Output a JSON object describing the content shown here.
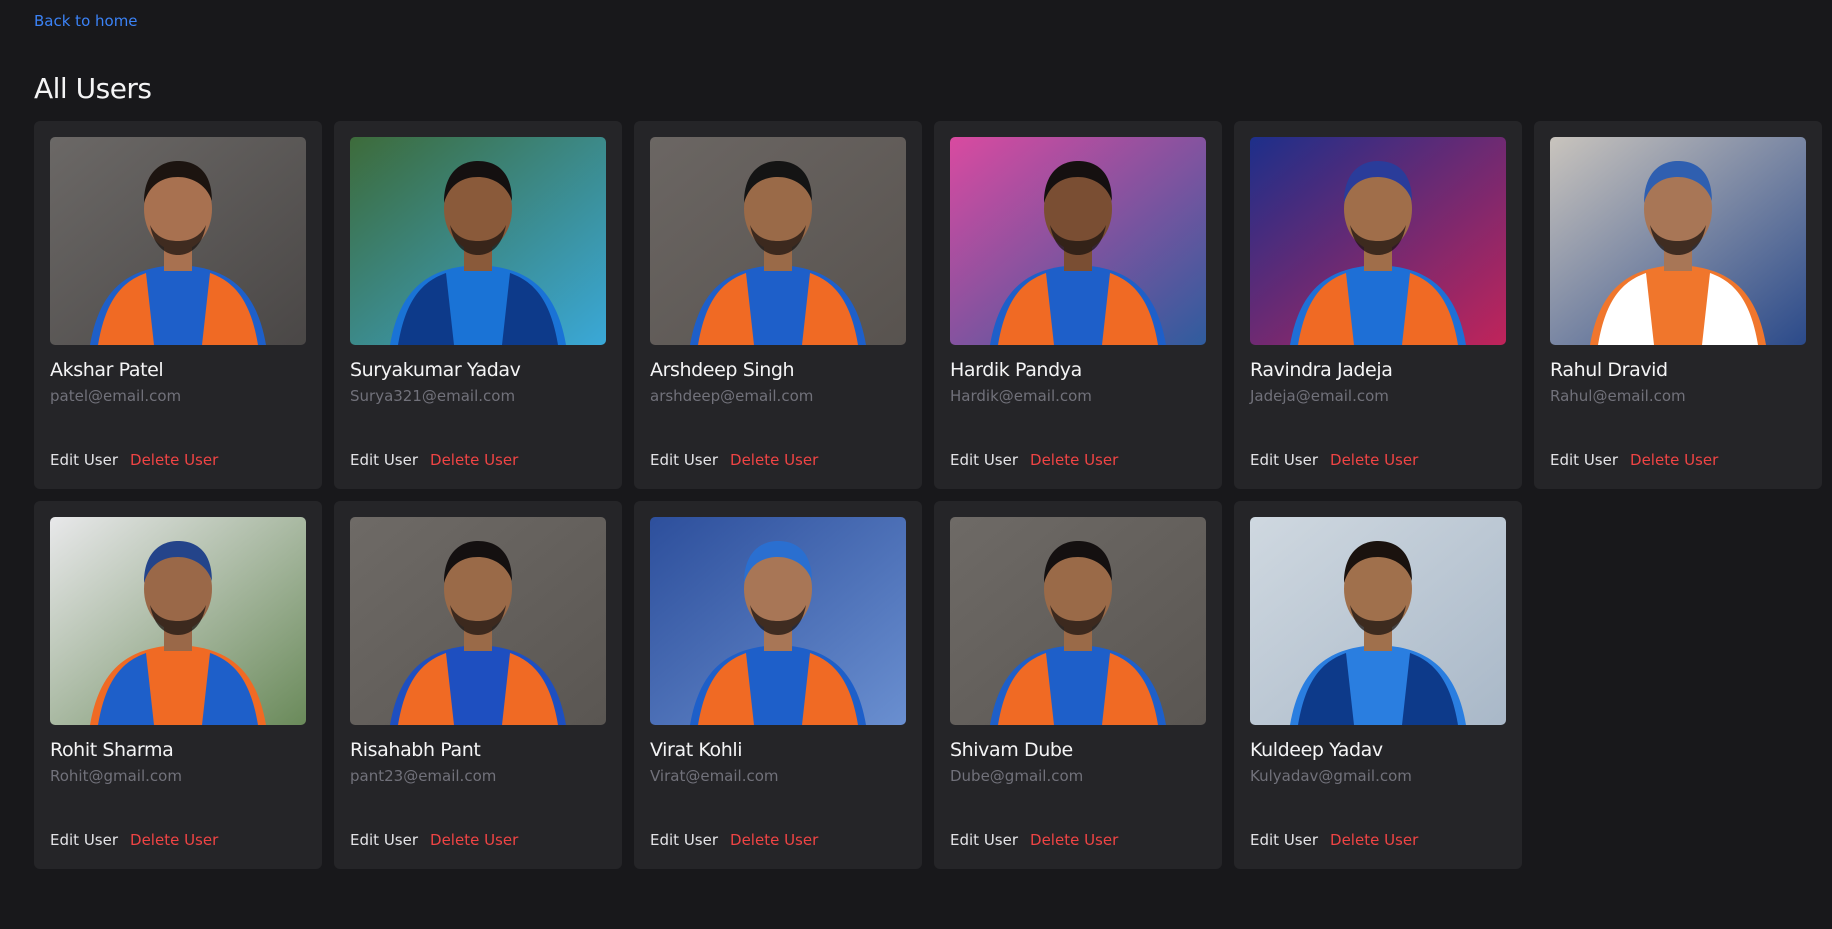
{
  "nav": {
    "back_label": "Back to home"
  },
  "header": {
    "title": "All Users"
  },
  "actions": {
    "edit_label": "Edit User",
    "delete_label": "Delete User"
  },
  "users": [
    {
      "name": "Akshar Patel",
      "email": "patel@email.com",
      "bg": "#6b6866",
      "bg2": "#4a4746",
      "skin": "#a87150",
      "jersey": "#1e5fc9",
      "accent": "#f06a24",
      "hair": "#1c1410"
    },
    {
      "name": "Suryakumar Yadav",
      "email": "Surya321@email.com",
      "bg": "#3d6b3a",
      "bg2": "#3aa8d8",
      "skin": "#8a5a3a",
      "jersey": "#1a73d6",
      "accent": "#0d3a8a",
      "hair": "#141010"
    },
    {
      "name": "Arshdeep Singh",
      "email": "arshdeep@email.com",
      "bg": "#6b6663",
      "bg2": "#58534f",
      "skin": "#9a6a48",
      "jersey": "#1e5fc9",
      "accent": "#f06a24",
      "hair": "#141414"
    },
    {
      "name": "Hardik Pandya",
      "email": "Hardik@email.com",
      "bg": "#d94aa0",
      "bg2": "#2f5c9e",
      "skin": "#7a4e33",
      "jersey": "#1e5fc9",
      "accent": "#f06a24",
      "hair": "#151010"
    },
    {
      "name": "Ravindra Jadeja",
      "email": "Jadeja@email.com",
      "bg": "#1d2f8a",
      "bg2": "#c0245a",
      "skin": "#a06e4a",
      "jersey": "#1e6fd6",
      "accent": "#f06a24",
      "hair": "#2a3c9a"
    },
    {
      "name": "Rahul Dravid",
      "email": "Rahul@email.com",
      "bg": "#c9c4bd",
      "bg2": "#2b4a8a",
      "skin": "#a87656",
      "jersey": "#f0762c",
      "accent": "#ffffff",
      "hair": "#2f5fb0"
    },
    {
      "name": "Rohit Sharma",
      "email": "Rohit@gmail.com",
      "bg": "#e8e8ea",
      "bg2": "#6a8a5a",
      "skin": "#9a6848",
      "jersey": "#f06a24",
      "accent": "#1e5fc9",
      "hair": "#24448a"
    },
    {
      "name": "Risahabh Pant",
      "email": "pant23@email.com",
      "bg": "#6e6a66",
      "bg2": "#5a5652",
      "skin": "#9a6a48",
      "jersey": "#1e4fc0",
      "accent": "#f06a24",
      "hair": "#141010"
    },
    {
      "name": "Virat Kohli",
      "email": "Virat@email.com",
      "bg": "#2d4f9c",
      "bg2": "#6a8fd0",
      "skin": "#a87656",
      "jersey": "#1e5fc9",
      "accent": "#f06a24",
      "hair": "#2a6fd0"
    },
    {
      "name": "Shivam Dube",
      "email": "Dube@gmail.com",
      "bg": "#6e6a66",
      "bg2": "#5a5652",
      "skin": "#9a6a48",
      "jersey": "#1e5fc9",
      "accent": "#f06a24",
      "hair": "#141010"
    },
    {
      "name": "Kuldeep Yadav",
      "email": "Kulyadav@gmail.com",
      "bg": "#cfd8e0",
      "bg2": "#a9b8c8",
      "skin": "#a0704c",
      "jersey": "#2a7ee0",
      "accent": "#0d3a8a",
      "hair": "#1a120e"
    }
  ]
}
